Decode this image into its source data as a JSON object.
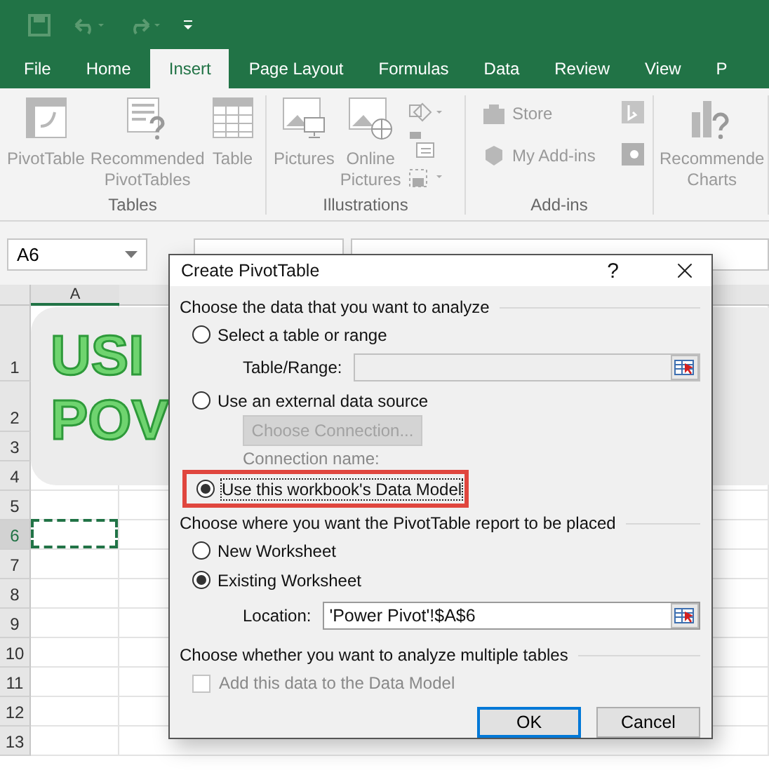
{
  "tabs": [
    {
      "label": "File",
      "selected": false
    },
    {
      "label": "Home",
      "selected": false
    },
    {
      "label": "Insert",
      "selected": true
    },
    {
      "label": "Page Layout",
      "selected": false
    },
    {
      "label": "Formulas",
      "selected": false
    },
    {
      "label": "Data",
      "selected": false
    },
    {
      "label": "Review",
      "selected": false
    },
    {
      "label": "View",
      "selected": false
    },
    {
      "label": "P",
      "selected": false
    }
  ],
  "ribbon": {
    "groups": [
      {
        "label": "Tables",
        "items": [
          {
            "lines": [
              "PivotTable"
            ]
          },
          {
            "lines": [
              "Recommended",
              "PivotTables"
            ]
          },
          {
            "lines": [
              "Table"
            ]
          }
        ]
      },
      {
        "label": "Illustrations",
        "items": [
          {
            "lines": [
              "Pictures"
            ]
          },
          {
            "lines": [
              "Online",
              "Pictures"
            ]
          }
        ]
      },
      {
        "label": "Add-ins",
        "items": [
          {
            "lines": [
              "Store"
            ]
          },
          {
            "lines": [
              "My Add-ins"
            ]
          }
        ]
      },
      {
        "items": [
          {
            "lines": [
              "Recommende",
              "Charts"
            ]
          }
        ]
      }
    ]
  },
  "name_box": "A6",
  "sheet": {
    "column": "A",
    "rows": [
      {
        "label": "1",
        "selected": false
      },
      {
        "label": "2",
        "selected": false
      },
      {
        "label": "3",
        "selected": false
      },
      {
        "label": "4",
        "selected": false
      },
      {
        "label": "5",
        "selected": false
      },
      {
        "label": "6",
        "selected": true
      },
      {
        "label": "7",
        "selected": false
      },
      {
        "label": "8",
        "selected": false
      },
      {
        "label": "9",
        "selected": false
      },
      {
        "label": "10",
        "selected": false
      },
      {
        "label": "11",
        "selected": false
      },
      {
        "label": "12",
        "selected": false
      },
      {
        "label": "13",
        "selected": false
      }
    ],
    "banner_lines": [
      "USI",
      "POV"
    ]
  },
  "dialog": {
    "title": "Create PivotTable",
    "help": "?",
    "source_heading": "Choose the data that you want to analyze",
    "source_options": [
      {
        "label": "Select a table or range",
        "selected": false,
        "highlighted": false
      },
      {
        "label": "Use an external data source",
        "selected": false,
        "highlighted": false
      },
      {
        "label": "Use this workbook's Data Model",
        "selected": true,
        "highlighted": true
      }
    ],
    "table_range": {
      "label": "Table/Range:",
      "disabled": true
    },
    "choose_connection": {
      "label": "Choose Connection...",
      "disabled": true
    },
    "connection_name": "Connection name:",
    "destination_heading": "Choose where you want the PivotTable report to be placed",
    "destination_options": [
      {
        "label": "New Worksheet",
        "selected": false
      },
      {
        "label": "Existing Worksheet",
        "selected": true
      }
    ],
    "location": {
      "label": "Location:",
      "value": "'Power Pivot'!$A$6",
      "disabled": false
    },
    "multiple_heading": "Choose whether you want to analyze multiple tables",
    "add_to_model": {
      "label": "Add this data to the Data Model",
      "checked": false,
      "disabled": true
    },
    "buttons": [
      {
        "label": "OK",
        "focused": true
      },
      {
        "label": "Cancel",
        "focused": false
      }
    ]
  }
}
